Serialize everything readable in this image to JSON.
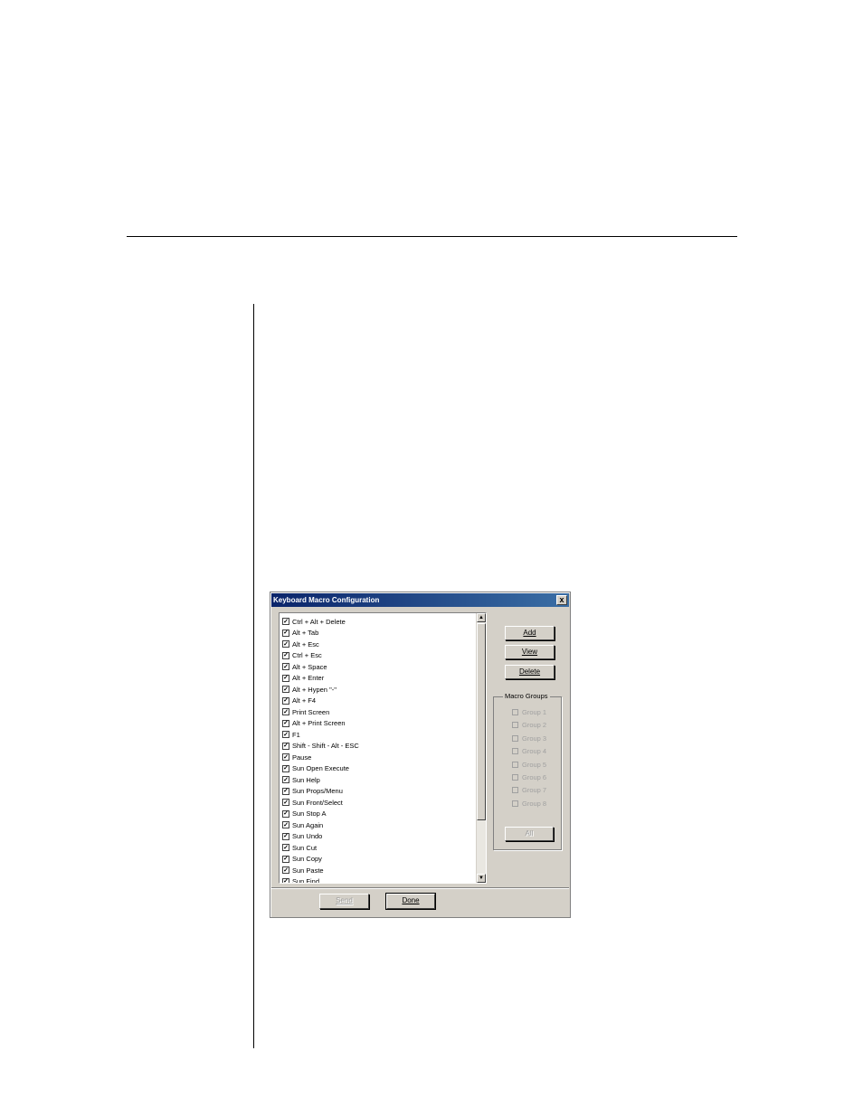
{
  "dialog": {
    "title": "Keyboard Macro Configuration",
    "close_label": "x",
    "macros": [
      {
        "label": "Ctrl + Alt + Delete",
        "checked": true
      },
      {
        "label": "Alt + Tab",
        "checked": true
      },
      {
        "label": "Alt + Esc",
        "checked": true
      },
      {
        "label": "Ctrl + Esc",
        "checked": true
      },
      {
        "label": "Alt + Space",
        "checked": true
      },
      {
        "label": "Alt + Enter",
        "checked": true
      },
      {
        "label": "Alt + Hypen \"-\"",
        "checked": true
      },
      {
        "label": "Alt + F4",
        "checked": true
      },
      {
        "label": "Print Screen",
        "checked": true
      },
      {
        "label": "Alt + Print Screen",
        "checked": true
      },
      {
        "label": "F1",
        "checked": true
      },
      {
        "label": "Shift - Shift - Alt - ESC",
        "checked": true
      },
      {
        "label": "Pause",
        "checked": true
      },
      {
        "label": "Sun Open Execute",
        "checked": true
      },
      {
        "label": "Sun Help",
        "checked": true
      },
      {
        "label": "Sun Props/Menu",
        "checked": true
      },
      {
        "label": "Sun Front/Select",
        "checked": true
      },
      {
        "label": "Sun Stop A",
        "checked": true
      },
      {
        "label": "Sun Again",
        "checked": true
      },
      {
        "label": "Sun Undo",
        "checked": true
      },
      {
        "label": "Sun Cut",
        "checked": true
      },
      {
        "label": "Sun Copy",
        "checked": true
      },
      {
        "label": "Sun Paste",
        "checked": true
      },
      {
        "label": "Sun Find",
        "checked": true
      }
    ],
    "buttons": {
      "add": "Add",
      "view": "View",
      "delete": "Delete",
      "all": "All",
      "send": "Send",
      "done": "Done"
    },
    "macro_groups": {
      "title": "Macro Groups",
      "items": [
        "Group 1",
        "Group 2",
        "Group 3",
        "Group 4",
        "Group 5",
        "Group 6",
        "Group 7",
        "Group 8"
      ]
    },
    "check_glyph": "✓",
    "scroll_up_glyph": "▲",
    "scroll_down_glyph": "▼"
  }
}
